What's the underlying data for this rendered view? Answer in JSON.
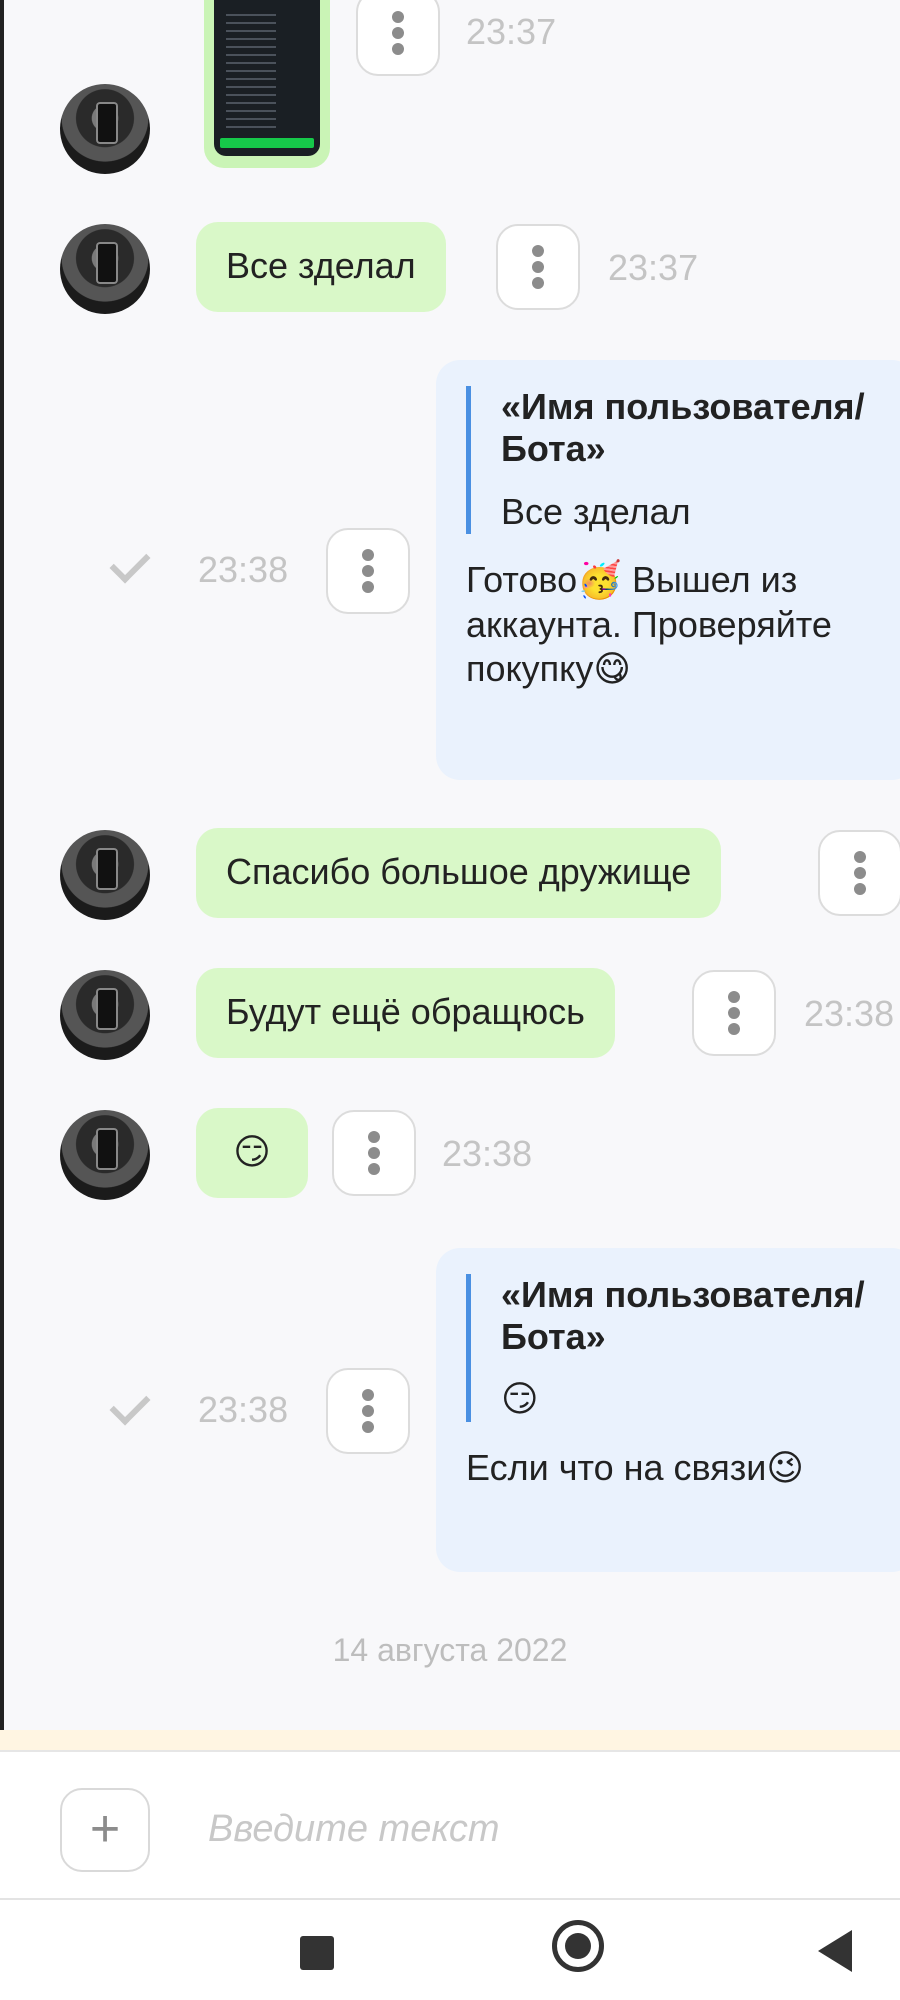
{
  "messages": [
    {
      "id": "m0",
      "direction": "in",
      "type": "image",
      "time": "23:37"
    },
    {
      "id": "m1",
      "direction": "in",
      "text": "Все зделал",
      "time": "23:37"
    },
    {
      "id": "m2",
      "direction": "out",
      "quote_title": "«Имя пользователя/ Бота»",
      "quote_text": "Все зделал",
      "text_part1": "Готово",
      "emoji1": "🥳",
      "text_part2": " Вышел из аккаунта. Проверяйте покупку",
      "emoji2": "😋",
      "time": "23:38",
      "status": "sent"
    },
    {
      "id": "m3",
      "direction": "in",
      "text": "Спасибо большое дружище"
    },
    {
      "id": "m4",
      "direction": "in",
      "text": "Будут ещё обращюсь",
      "time": "23:38"
    },
    {
      "id": "m5",
      "direction": "in",
      "text": "😏",
      "time": "23:38"
    },
    {
      "id": "m6",
      "direction": "out",
      "quote_title": "«Имя пользователя/ Бота»",
      "quote_text": "😏",
      "text_part1": "Если что на связи",
      "emoji1": "😉",
      "time": "23:38",
      "status": "sent"
    }
  ],
  "date_separator": "14 августа 2022",
  "composer": {
    "placeholder": "Введите текст",
    "add_label": "+"
  },
  "colors": {
    "incoming_bubble": "#d9f8c8",
    "outgoing_bubble": "#eaf2fd",
    "quote_bar": "#4a90e2",
    "background": "#f8f8fa"
  },
  "icons": {
    "menu": "vertical-dots-icon",
    "sent": "check-icon",
    "add": "plus-icon",
    "nav_recents": "square-icon",
    "nav_home": "circle-icon",
    "nav_back": "triangle-back-icon"
  }
}
